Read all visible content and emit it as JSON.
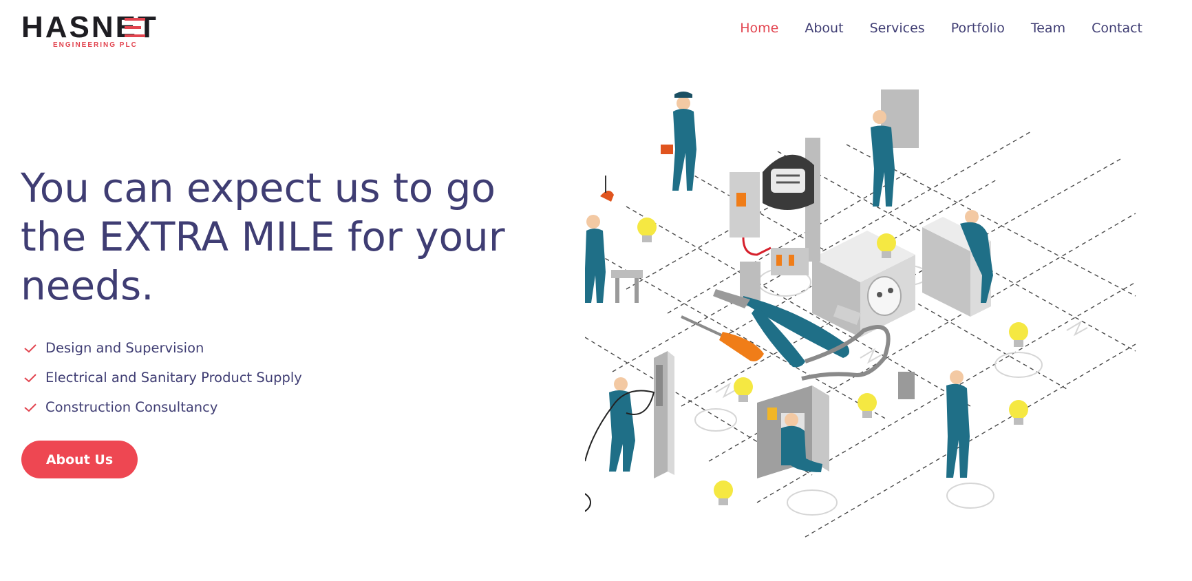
{
  "brand": {
    "name_left": "HAS",
    "name_right": "NET",
    "tagline": "ENGINEERING  PLC",
    "accent_color": "#e2444f",
    "dark_color": "#1e1d22"
  },
  "nav": {
    "items": [
      {
        "label": "Home",
        "active": true
      },
      {
        "label": "About",
        "active": false
      },
      {
        "label": "Services",
        "active": false
      },
      {
        "label": "Portfolio",
        "active": false
      },
      {
        "label": "Team",
        "active": false
      },
      {
        "label": "Contact",
        "active": false
      }
    ]
  },
  "hero": {
    "title_line1": "You can expect us to go",
    "title_line2": "the EXTRA MILE for your",
    "title_line3": "needs.",
    "features": [
      {
        "icon": "check-icon",
        "label": "Design and Supervision"
      },
      {
        "icon": "check-icon",
        "label": "Electrical and Sanitary Product Supply"
      },
      {
        "icon": "check-icon",
        "label": "Construction Consultancy"
      }
    ],
    "cta_label": "About Us"
  },
  "colors": {
    "text": "#3f3d73",
    "button": "#ee4752",
    "teal_worker": "#1f6f87",
    "bulb": "#f5e842"
  }
}
